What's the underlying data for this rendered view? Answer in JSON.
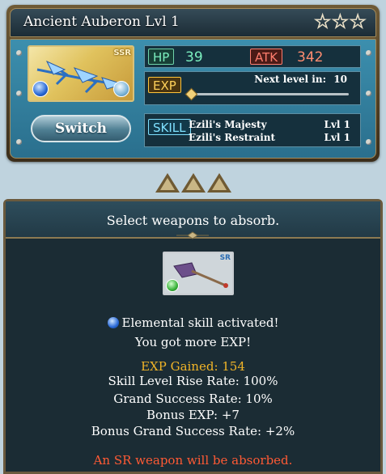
{
  "weapon_card": {
    "title": "Ancient Auberon Lvl 1",
    "stars_total": 3,
    "stars_filled": 0,
    "rarity": "SSR",
    "element_icon": "water-element-icon",
    "switch_label": "Switch",
    "hp_label": "HP",
    "hp_value": "39",
    "atk_label": "ATK",
    "atk_value": "342",
    "exp_label": "EXP",
    "next_level_label": "Next level in:",
    "next_level_value": "10",
    "exp_progress": 0.0,
    "skill_label": "SKILL",
    "skills": [
      {
        "name": "Ezili's Majesty",
        "level": "Lvl 1"
      },
      {
        "name": "Ezili's Restraint",
        "level": "Lvl 1"
      }
    ]
  },
  "absorb_panel": {
    "title": "Select weapons to absorb.",
    "selected_weapon": {
      "rarity": "SR",
      "element_icon": "wind-element-icon"
    },
    "messages": {
      "elemental": "Elemental skill activated!",
      "more_exp": "You got more EXP!",
      "exp_gained": "EXP Gained: 154",
      "skill_rate": "Skill Level Rise Rate: 100%",
      "grand_rate": "Grand Success Rate: 10%",
      "bonus_exp": "Bonus EXP: +7",
      "bonus_grand": "Bonus Grand Success Rate: +2%",
      "warning": "An SR weapon will be absorbed."
    }
  },
  "colors": {
    "hp": "#7cf0c0",
    "atk": "#ff7d6d",
    "exp": "#ffd15a",
    "skill": "#7fe1ff",
    "exp_gained": "#f0b428",
    "warning": "#ff5a34"
  }
}
